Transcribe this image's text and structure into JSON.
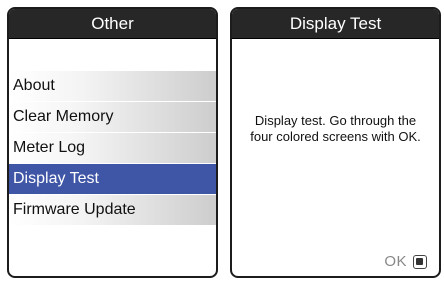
{
  "left_screen": {
    "title": "Other",
    "menu": [
      {
        "label": "About",
        "selected": false
      },
      {
        "label": "Clear Memory",
        "selected": false
      },
      {
        "label": "Meter Log",
        "selected": false
      },
      {
        "label": "Display Test",
        "selected": true
      },
      {
        "label": "Firmware Update",
        "selected": false
      }
    ]
  },
  "right_screen": {
    "title": "Display Test",
    "message_line1": "Display test. Go through the",
    "message_line2": "four colored screens with OK.",
    "softkey_label": "OK",
    "softkey_icon": "ok-button-icon"
  },
  "colors": {
    "title_bar": "#272727",
    "selected_item": "#3f55a6"
  }
}
